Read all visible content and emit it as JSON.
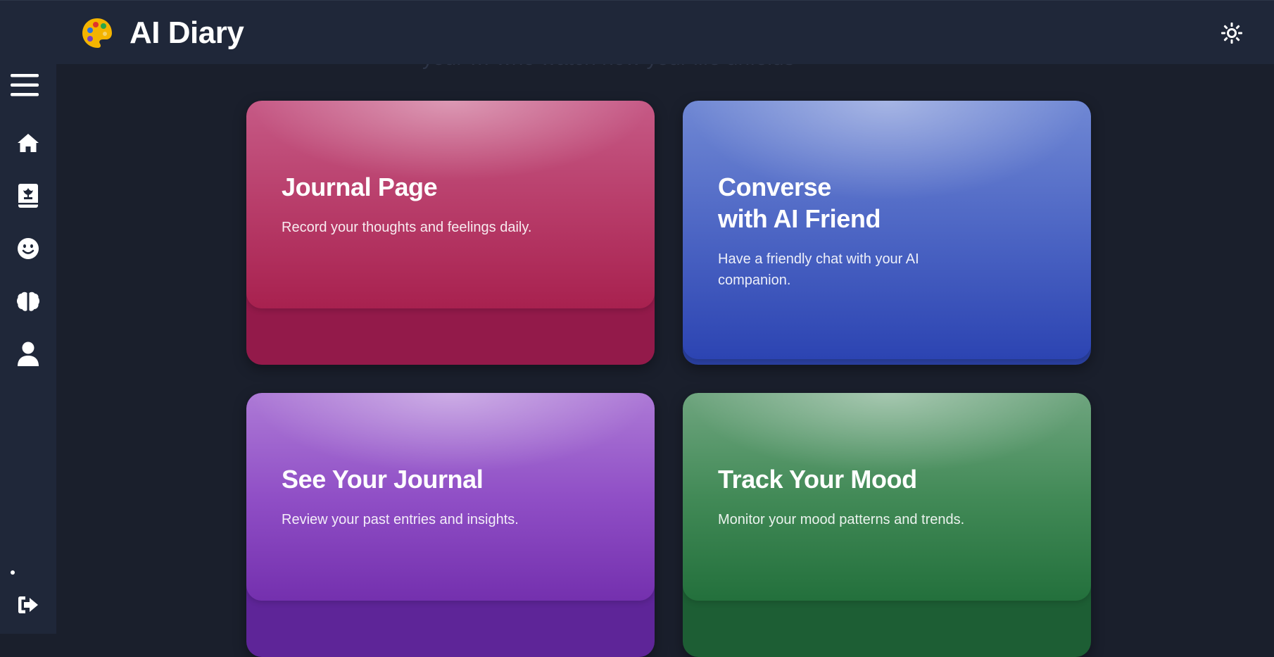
{
  "header": {
    "app_title": "AI Diary",
    "logo_icon": "artist-palette-icon",
    "theme_toggle_icon": "sun-icon"
  },
  "background": {
    "ghost_text": "your … who watch how your life unfolds"
  },
  "sidebar": {
    "items": [
      {
        "id": "menu",
        "icon": "hamburger-menu-icon"
      },
      {
        "id": "home",
        "icon": "home-icon"
      },
      {
        "id": "journal",
        "icon": "journal-book-icon"
      },
      {
        "id": "mood",
        "icon": "smile-icon"
      },
      {
        "id": "insights",
        "icon": "brain-icon"
      },
      {
        "id": "profile",
        "icon": "user-icon"
      }
    ],
    "logout_icon": "logout-icon"
  },
  "cards": [
    {
      "id": "journal-page",
      "title": "Journal Page",
      "description": "Record your thoughts and feelings daily.",
      "color": "#a8214f"
    },
    {
      "id": "converse",
      "title_line1": "Converse",
      "title_line2": "with AI Friend",
      "description": "Have a friendly chat with your AI companion.",
      "color": "#2c44b2"
    },
    {
      "id": "see-journal",
      "title": "See Your Journal",
      "description": "Review your past entries and insights.",
      "color": "#7430ae"
    },
    {
      "id": "track-mood",
      "title": "Track Your Mood",
      "description": "Monitor your mood patterns and trends.",
      "color": "#23703c"
    }
  ]
}
